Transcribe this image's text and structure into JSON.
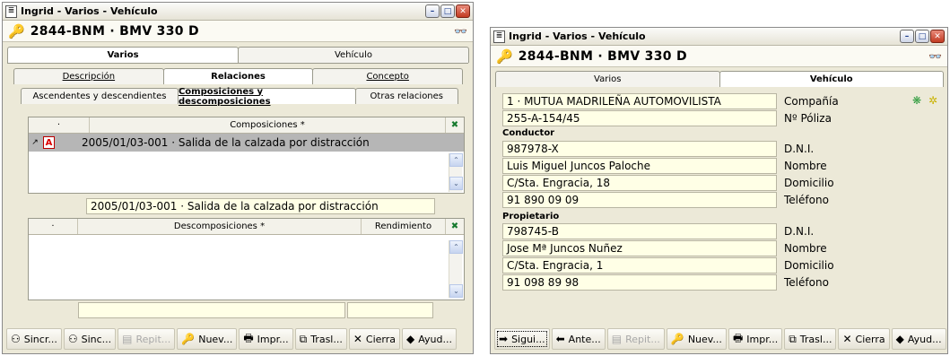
{
  "left_window": {
    "title": "Ingrid - Varios - Vehículo",
    "header": "2844-BNM · BMV 330 D",
    "main_tabs": [
      "Varios",
      "Vehículo"
    ],
    "sub_tabs": [
      "Descripción",
      "Relaciones",
      "Concepto"
    ],
    "rel_tabs": [
      "Ascendentes y descendientes",
      "Composiciones y descomposiciones",
      "Otras relaciones"
    ],
    "composiciones": {
      "col_dot": "·",
      "col_title": "Composiciones *",
      "rows": [
        {
          "text": "2005/01/03-001 · Salida de la calzada por distracción"
        }
      ],
      "detail": "2005/01/03-001 · Salida de la calzada por distracción"
    },
    "descomposiciones": {
      "col_dot": "·",
      "col_title": "Descomposiciones *",
      "col_rend": "Rendimiento"
    },
    "toolbar": [
      {
        "icon": "sync-icon",
        "glyph": "⚇",
        "label": "Sincr...",
        "enabled": true
      },
      {
        "icon": "sync-icon",
        "glyph": "⚇",
        "label": "Sinc...",
        "enabled": true
      },
      {
        "icon": "repeat-icon",
        "glyph": "▤",
        "label": "Repit...",
        "enabled": false
      },
      {
        "icon": "key-icon",
        "glyph": "🔑",
        "label": "Nuev...",
        "enabled": true
      },
      {
        "icon": "printer-icon",
        "glyph": "🖶",
        "label": "Impr...",
        "enabled": true
      },
      {
        "icon": "transfer-icon",
        "glyph": "⧉",
        "label": "Trasl...",
        "enabled": true
      },
      {
        "icon": "close-icon",
        "glyph": "✕",
        "label": "Cierra",
        "enabled": true
      },
      {
        "icon": "help-icon",
        "glyph": "◆",
        "label": "Ayud...",
        "enabled": true
      }
    ]
  },
  "right_window": {
    "title": "Ingrid - Varios - Vehículo",
    "header": "2844-BNM · BMV 330 D",
    "main_tabs": [
      "Varios",
      "Vehículo"
    ],
    "compania": {
      "value": "1 · MUTUA MADRILEÑA AUTOMOVILISTA",
      "label": "Compañía"
    },
    "poliza": {
      "value": "255-A-154/45",
      "label": "Nº Póliza"
    },
    "conductor": {
      "section": "Conductor",
      "dni": {
        "value": "987978-X",
        "label": "D.N.I."
      },
      "nombre": {
        "value": "Luis Miguel Juncos Paloche",
        "label": "Nombre"
      },
      "domicilio": {
        "value": "C/Sta. Engracia, 18",
        "label": "Domicilio"
      },
      "telefono": {
        "value": "91 890 09 09",
        "label": "Teléfono"
      }
    },
    "propietario": {
      "section": "Propietario",
      "dni": {
        "value": "798745-B",
        "label": "D.N.I."
      },
      "nombre": {
        "value": "Jose Mª Juncos Nuñez",
        "label": "Nombre"
      },
      "domicilio": {
        "value": "C/Sta. Engracia, 1",
        "label": "Domicilio"
      },
      "telefono": {
        "value": "91 098 89 98",
        "label": "Teléfono"
      }
    },
    "toolbar": [
      {
        "icon": "next-icon",
        "glyph": "➡",
        "label": "Sigui...",
        "enabled": true
      },
      {
        "icon": "prev-icon",
        "glyph": "⬅",
        "label": "Ante...",
        "enabled": true
      },
      {
        "icon": "repeat-icon",
        "glyph": "▤",
        "label": "Repit...",
        "enabled": false
      },
      {
        "icon": "key-icon",
        "glyph": "🔑",
        "label": "Nuev...",
        "enabled": true
      },
      {
        "icon": "printer-icon",
        "glyph": "🖶",
        "label": "Impr...",
        "enabled": true
      },
      {
        "icon": "transfer-icon",
        "glyph": "⧉",
        "label": "Trasl...",
        "enabled": true
      },
      {
        "icon": "close-icon",
        "glyph": "✕",
        "label": "Cierra",
        "enabled": true
      },
      {
        "icon": "help-icon",
        "glyph": "◆",
        "label": "Ayud...",
        "enabled": true
      }
    ]
  },
  "colors": {
    "field_bg": "#ffffe6",
    "window_bg": "#ece9d8",
    "selected_row": "#b6b6b6"
  }
}
